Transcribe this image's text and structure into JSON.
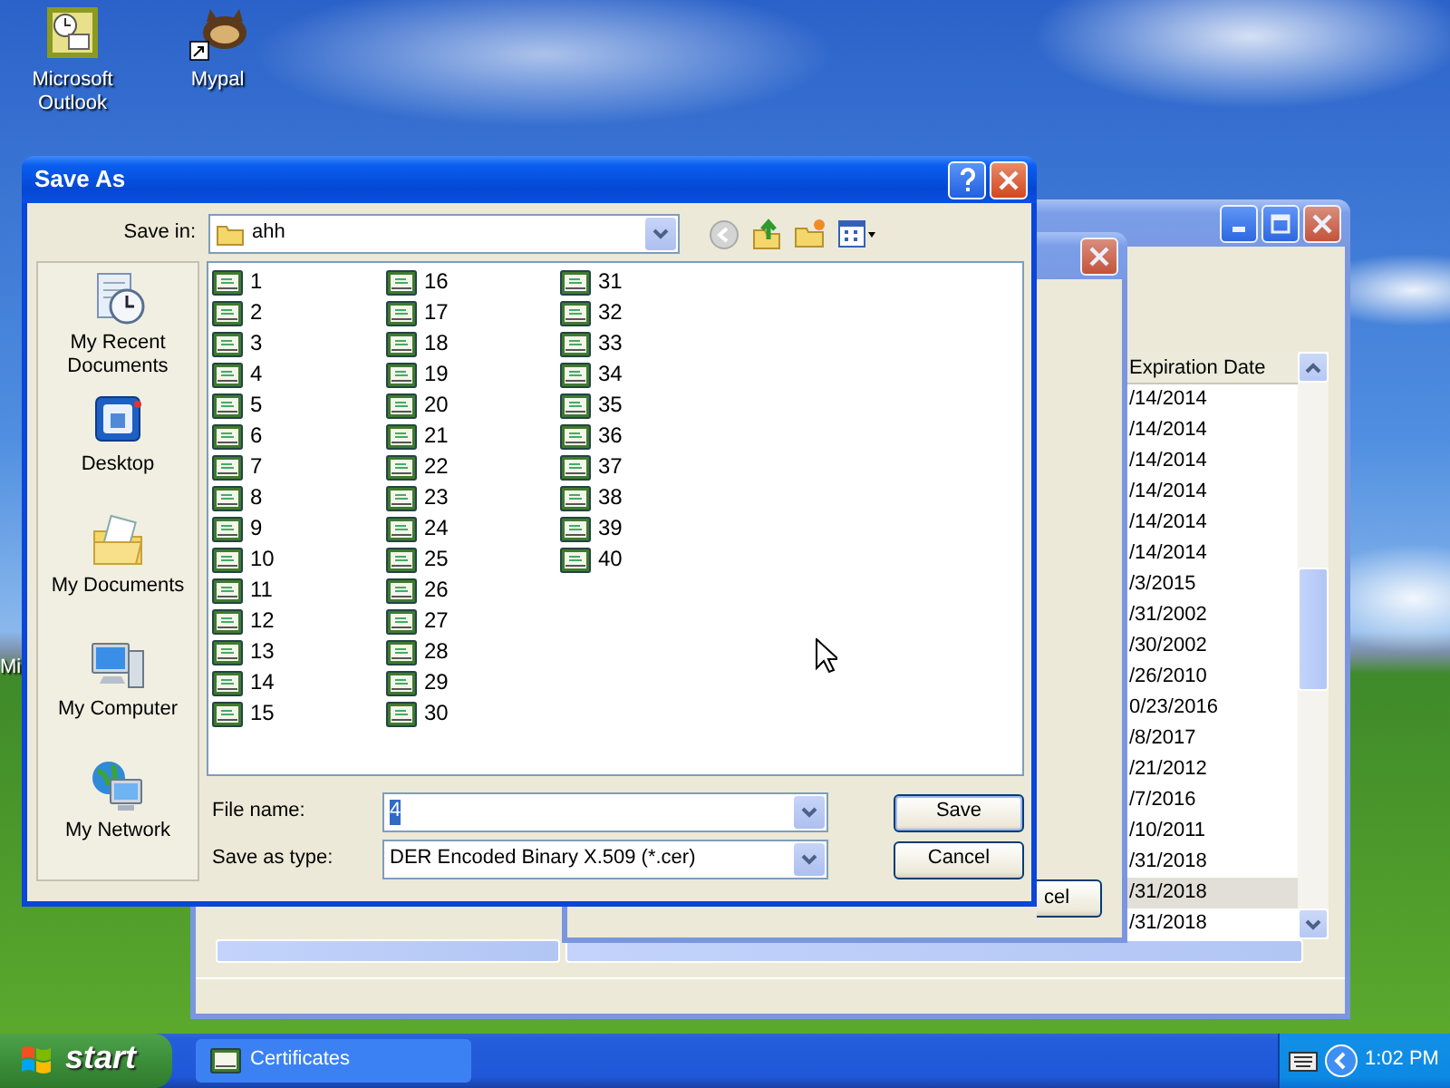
{
  "desktop_icons": [
    {
      "label": "Microsoft Outlook",
      "kind": "outlook"
    },
    {
      "label": "Mypal",
      "kind": "animal"
    }
  ],
  "desktop_partial_label": "Mi",
  "certificates_window": {
    "column": "Expiration Date",
    "rows": [
      {
        "expiration": "/14/2014",
        "selected": false
      },
      {
        "expiration": "/14/2014",
        "selected": false
      },
      {
        "expiration": "/14/2014",
        "selected": false
      },
      {
        "expiration": "/14/2014",
        "selected": false
      },
      {
        "expiration": "/14/2014",
        "selected": false
      },
      {
        "expiration": "/14/2014",
        "selected": false
      },
      {
        "expiration": "/3/2015",
        "selected": false
      },
      {
        "expiration": "/31/2002",
        "selected": false
      },
      {
        "expiration": "/30/2002",
        "selected": false
      },
      {
        "expiration": "/26/2010",
        "selected": false
      },
      {
        "expiration": "0/23/2016",
        "selected": false
      },
      {
        "expiration": "/8/2017",
        "selected": false
      },
      {
        "expiration": "/21/2012",
        "selected": false
      },
      {
        "expiration": "/7/2016",
        "selected": false
      },
      {
        "expiration": "/10/2011",
        "selected": false
      },
      {
        "expiration": "/31/2018",
        "selected": false
      },
      {
        "expiration": "/31/2018",
        "selected": true
      },
      {
        "expiration": "/31/2018",
        "selected": false
      }
    ]
  },
  "partial_dialog": {
    "button": "cel"
  },
  "save_as": {
    "title": "Save As",
    "save_in_label": "Save in:",
    "save_in": "ahh",
    "places": [
      {
        "label": "My Recent Documents",
        "kind": "recent"
      },
      {
        "label": "Desktop",
        "kind": "desktop"
      },
      {
        "label": "My Documents",
        "kind": "documents"
      },
      {
        "label": "My Computer",
        "kind": "computer"
      },
      {
        "label": "My Network",
        "kind": "network"
      }
    ],
    "files": [
      {
        "name": "1"
      },
      {
        "name": "2"
      },
      {
        "name": "3"
      },
      {
        "name": "4"
      },
      {
        "name": "5"
      },
      {
        "name": "6"
      },
      {
        "name": "7"
      },
      {
        "name": "8"
      },
      {
        "name": "9"
      },
      {
        "name": "10"
      },
      {
        "name": "11"
      },
      {
        "name": "12"
      },
      {
        "name": "13"
      },
      {
        "name": "14"
      },
      {
        "name": "15"
      },
      {
        "name": "16"
      },
      {
        "name": "17"
      },
      {
        "name": "18"
      },
      {
        "name": "19"
      },
      {
        "name": "20"
      },
      {
        "name": "21"
      },
      {
        "name": "22"
      },
      {
        "name": "23"
      },
      {
        "name": "24"
      },
      {
        "name": "25"
      },
      {
        "name": "26"
      },
      {
        "name": "27"
      },
      {
        "name": "28"
      },
      {
        "name": "29"
      },
      {
        "name": "30"
      },
      {
        "name": "31"
      },
      {
        "name": "32"
      },
      {
        "name": "33"
      },
      {
        "name": "34"
      },
      {
        "name": "35"
      },
      {
        "name": "36"
      },
      {
        "name": "37"
      },
      {
        "name": "38"
      },
      {
        "name": "39"
      },
      {
        "name": "40"
      }
    ],
    "file_name_label": "File name:",
    "file_name": "4",
    "type_label": "Save as type:",
    "type": "DER Encoded Binary X.509 (*.cer)",
    "buttons": [
      "Save",
      "Cancel"
    ]
  },
  "taskbar": {
    "start": "start",
    "tasks": [
      {
        "label": "Certificates",
        "selected": false
      }
    ],
    "clock": "1:02 PM"
  }
}
